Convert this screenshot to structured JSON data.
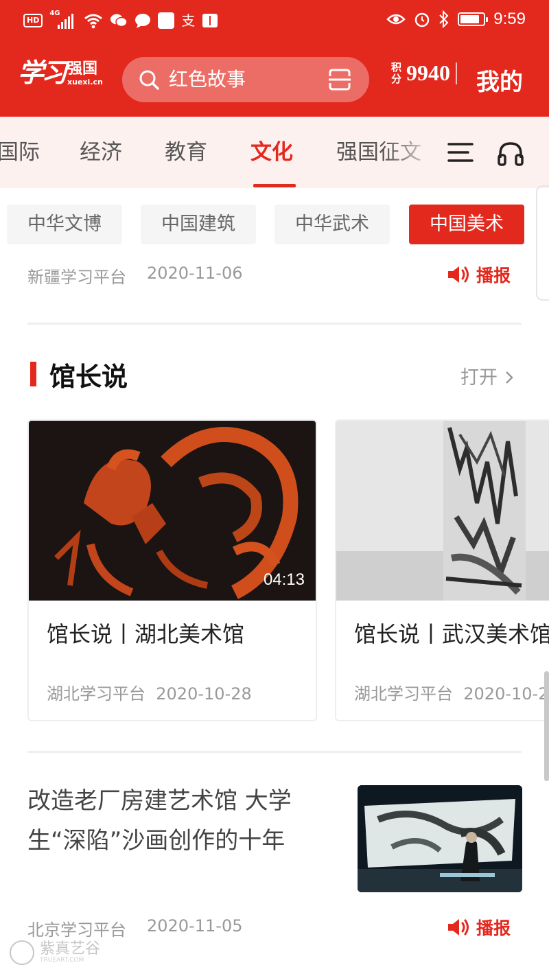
{
  "status_bar": {
    "hd": "HD",
    "network": "4G",
    "time": "9:59",
    "battery_level": 0.85
  },
  "header": {
    "logo_script": "学习",
    "logo_text": "强国",
    "logo_sub": "xuexi.cn",
    "search_placeholder": "红色故事",
    "points_label": "积分",
    "points_value": "9940",
    "mine_label": "我的"
  },
  "tabs": [
    {
      "label": "国际",
      "active": false
    },
    {
      "label": "经济",
      "active": false
    },
    {
      "label": "教育",
      "active": false
    },
    {
      "label": "文化",
      "active": true
    },
    {
      "label": "强国征文",
      "active": false
    }
  ],
  "chips": [
    {
      "label": "中华文博",
      "active": false
    },
    {
      "label": "中国建筑",
      "active": false
    },
    {
      "label": "中华武术",
      "active": false
    },
    {
      "label": "中国美术",
      "active": true
    }
  ],
  "article1": {
    "source": "新疆学习平台",
    "date": "2020-11-06",
    "broadcast_label": "播报"
  },
  "section": {
    "title": "馆长说",
    "open_label": "打开",
    "cards": [
      {
        "title": "馆长说丨湖北美术馆",
        "source": "湖北学习平台",
        "date": "2020-10-28",
        "duration": "04:13"
      },
      {
        "title": "馆长说丨武汉美术馆",
        "source": "湖北学习平台",
        "date": "2020-10-2"
      }
    ]
  },
  "article2": {
    "title": "改造老厂房建艺术馆 大学生“深陷”沙画创作的十年",
    "source": "北京学习平台",
    "date": "2020-11-05",
    "broadcast_label": "播报"
  },
  "watermark": {
    "text": "紫真艺谷",
    "sub": "TRUEART.COM"
  },
  "colors": {
    "brand_red": "#e3291e",
    "tab_bg": "#fdf1f0",
    "muted_text": "#999999"
  }
}
